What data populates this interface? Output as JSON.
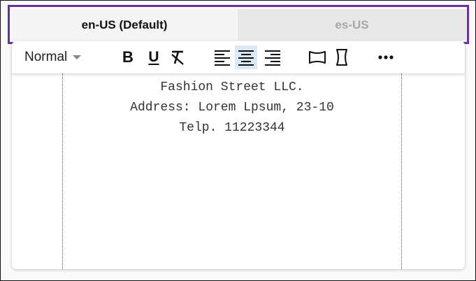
{
  "tabs": [
    {
      "label": "en-US (Default)",
      "active": true
    },
    {
      "label": "es-US",
      "active": false
    }
  ],
  "toolbar": {
    "style_value": "Normal",
    "bold_icon": "bold-icon",
    "underline_icon": "underline-icon",
    "clear_format_icon": "clear-format-icon",
    "align_left_icon": "align-left-icon",
    "align_center_icon": "align-center-icon",
    "align_right_icon": "align-right-icon",
    "margin_horizontal_icon": "page-margin-horizontal-icon",
    "margin_vertical_icon": "page-margin-vertical-icon",
    "more_icon": "more-icon",
    "active_alignment": "center"
  },
  "document": {
    "lines": [
      "Fashion Street LLC.",
      "Address: Lorem Lpsum, 23-10",
      "Telp. 11223344"
    ]
  },
  "colors": {
    "tab_outline": "#6a2fa0",
    "selected_button": "#dbe8f7",
    "inactive_tab_text": "#a8a8a8"
  }
}
